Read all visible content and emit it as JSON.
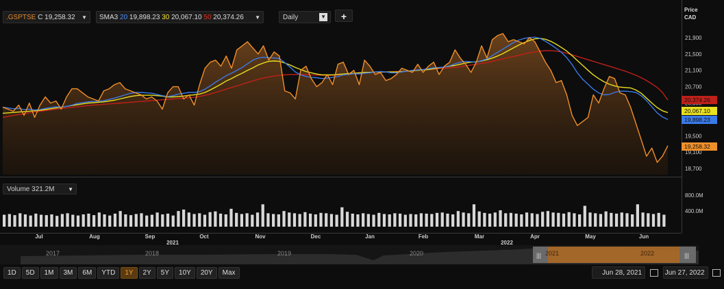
{
  "header": {
    "symbol": ".GSPTSE",
    "symbol_value": "C 19,258.32",
    "sma_label": "SMA3",
    "sma": [
      {
        "period": "20",
        "value": "19,898.23",
        "color": "#4a90ff"
      },
      {
        "period": "30",
        "value": "20,067.10",
        "color": "#f0e030"
      },
      {
        "period": "50",
        "value": "20,374.26",
        "color": "#e03020"
      }
    ],
    "interval": "Daily",
    "add_icon": "plus-icon"
  },
  "price_axis": {
    "title_line1": "Price",
    "title_line2": "CAD"
  },
  "volume": {
    "label": "Volume 321.2M",
    "ticks": [
      "800.0M",
      "400.0M"
    ]
  },
  "time_range": {
    "start": "Jun 28, 2021",
    "end": "Jun 27, 2022"
  },
  "periods": [
    "1D",
    "5D",
    "1M",
    "3M",
    "6M",
    "YTD",
    "1Y",
    "2Y",
    "5Y",
    "10Y",
    "20Y",
    "Max"
  ],
  "active_period": "1Y",
  "navigator_years": [
    "2017",
    "2018",
    "2019",
    "2020",
    "2021",
    "2022"
  ],
  "chart_data": {
    "type": "area",
    "x_labels": [
      "Jul",
      "Aug",
      "Sep",
      "Oct",
      "Nov",
      "Dec",
      "Jan",
      "Feb",
      "Mar",
      "Apr",
      "May",
      "Jun"
    ],
    "year_labels": [
      "2021",
      "2022"
    ],
    "y_ticks": [
      18700,
      19100,
      19500,
      20300,
      20700,
      21100,
      21500,
      21900
    ],
    "y_tick_labels": [
      "18,700",
      "19,100",
      "19,500",
      "20,300",
      "20,700",
      "21,100",
      "21,500",
      "21,900"
    ],
    "ylim": [
      18550,
      22150
    ],
    "price_tags": [
      {
        "label": "20,374.26",
        "value": 20374,
        "color": "#c0201a"
      },
      {
        "label": "20,067.10",
        "value": 20067,
        "color": "#e8e020"
      },
      {
        "label": "19,898.23",
        "value": 19898,
        "color": "#3a7ae8"
      },
      {
        "label": "19,258.32",
        "value": 19258,
        "color": "#f0902a"
      }
    ],
    "series": [
      {
        "values": [
          20200,
          20150,
          20100,
          20250,
          20000,
          20300,
          19950,
          20250,
          20450,
          20300,
          20350,
          20150,
          20450,
          20650,
          20650,
          20550,
          20450,
          20400,
          20350,
          20600,
          20650,
          20750,
          20800,
          20650,
          20600,
          20550,
          20500,
          20400,
          20450,
          20350,
          20150,
          20550,
          20700,
          20700,
          20400,
          20500,
          20250,
          20750,
          21150,
          21300,
          21350,
          21200,
          21450,
          21150,
          21600,
          21700,
          21800,
          21650,
          21500,
          21700,
          21350,
          21550,
          21450,
          20600,
          20550,
          20400,
          21100,
          21200,
          20900,
          20700,
          20800,
          21000,
          20750,
          21250,
          21300,
          21000,
          21100,
          20750,
          21350,
          21200,
          21000,
          21050,
          20850,
          20900,
          21000,
          21150,
          21100,
          21050,
          21250,
          21050,
          21200,
          21300,
          21000,
          21200,
          21300,
          21600,
          21400,
          21250,
          21050,
          21300,
          21700,
          21400,
          21850,
          21950,
          22000,
          21800,
          21850,
          21800,
          21750,
          21900,
          21800,
          21550,
          21300,
          21100,
          20800,
          20850,
          20500,
          20000,
          19750,
          19850,
          19950,
          20500,
          20300,
          20650,
          20950,
          20900,
          20550,
          20500,
          20200,
          19800,
          19400,
          19000,
          19200,
          18850,
          19000,
          19258
        ]
      },
      {
        "values": [
          20200,
          20180,
          20160,
          20170,
          20140,
          20150,
          20130,
          20140,
          20170,
          20190,
          20210,
          20200,
          20220,
          20250,
          20290,
          20310,
          20330,
          20340,
          20340,
          20360,
          20390,
          20420,
          20460,
          20500,
          20540,
          20560,
          20560,
          20550,
          20540,
          20510,
          20480,
          20460,
          20480,
          20520,
          20540,
          20560,
          20560,
          20580,
          20640,
          20720,
          20810,
          20890,
          20970,
          21030,
          21100,
          21170,
          21260,
          21350,
          21400,
          21420,
          21410,
          21400,
          21390,
          21290,
          21180,
          21060,
          20990,
          20950,
          20930,
          20920,
          20900,
          20910,
          20930,
          20950,
          20990,
          21000,
          21020,
          21010,
          21030,
          21040,
          21060,
          21070,
          21060,
          21040,
          21040,
          21060,
          21080,
          21100,
          21110,
          21120,
          21140,
          21160,
          21170,
          21180,
          21210,
          21260,
          21300,
          21320,
          21310,
          21300,
          21340,
          21380,
          21460,
          21540,
          21620,
          21700,
          21780,
          21840,
          21880,
          21900,
          21910,
          21880,
          21810,
          21730,
          21640,
          21540,
          21410,
          21240,
          21040,
          20880,
          20760,
          20640,
          20550,
          20500,
          20510,
          20560,
          20590,
          20590,
          20580,
          20560,
          20480,
          20360,
          20210,
          20060,
          19960,
          19898
        ]
      },
      {
        "values": [
          20050,
          20060,
          20070,
          20080,
          20090,
          20100,
          20110,
          20120,
          20140,
          20160,
          20180,
          20200,
          20220,
          20240,
          20260,
          20280,
          20300,
          20310,
          20320,
          20330,
          20350,
          20370,
          20400,
          20430,
          20460,
          20480,
          20490,
          20490,
          20490,
          20480,
          20470,
          20450,
          20450,
          20460,
          20470,
          20490,
          20500,
          20520,
          20560,
          20620,
          20690,
          20760,
          20840,
          20900,
          20970,
          21030,
          21100,
          21160,
          21230,
          21280,
          21320,
          21330,
          21320,
          21280,
          21230,
          21170,
          21120,
          21070,
          21040,
          21010,
          20990,
          20990,
          20990,
          21000,
          21010,
          21020,
          21030,
          21040,
          21050,
          21050,
          21060,
          21060,
          21060,
          21060,
          21060,
          21070,
          21080,
          21090,
          21100,
          21110,
          21120,
          21140,
          21160,
          21180,
          21200,
          21220,
          21250,
          21280,
          21300,
          21310,
          21330,
          21360,
          21400,
          21450,
          21510,
          21580,
          21650,
          21720,
          21780,
          21830,
          21870,
          21880,
          21860,
          21810,
          21740,
          21660,
          21570,
          21460,
          21340,
          21220,
          21100,
          20990,
          20900,
          20820,
          20760,
          20720,
          20690,
          20680,
          20670,
          20620,
          20540,
          20420,
          20300,
          20190,
          20110,
          20067
        ]
      },
      {
        "values": [
          19950,
          19975,
          20000,
          20020,
          20040,
          20060,
          20080,
          20100,
          20115,
          20130,
          20150,
          20165,
          20180,
          20195,
          20210,
          20225,
          20240,
          20250,
          20260,
          20270,
          20280,
          20290,
          20300,
          20310,
          20320,
          20330,
          20340,
          20350,
          20360,
          20370,
          20380,
          20390,
          20400,
          20410,
          20420,
          20430,
          20440,
          20460,
          20490,
          20520,
          20560,
          20600,
          20640,
          20680,
          20720,
          20760,
          20800,
          20840,
          20880,
          20910,
          20940,
          20960,
          20980,
          20990,
          21000,
          21000,
          21000,
          20995,
          20990,
          20985,
          20980,
          20980,
          20980,
          20990,
          21000,
          21010,
          21020,
          21030,
          21040,
          21045,
          21050,
          21055,
          21060,
          21065,
          21070,
          21075,
          21080,
          21090,
          21100,
          21110,
          21120,
          21130,
          21140,
          21150,
          21160,
          21170,
          21190,
          21210,
          21230,
          21250,
          21270,
          21290,
          21320,
          21350,
          21380,
          21410,
          21440,
          21470,
          21500,
          21530,
          21550,
          21570,
          21580,
          21580,
          21570,
          21550,
          21520,
          21480,
          21440,
          21400,
          21360,
          21320,
          21280,
          21240,
          21200,
          21160,
          21120,
          21080,
          21030,
          20980,
          20920,
          20850,
          20770,
          20680,
          20560,
          20374
        ]
      }
    ],
    "volume_values": [
      320,
      340,
      310,
      360,
      330,
      300,
      350,
      320,
      310,
      330,
      290,
      340,
      360,
      320,
      300,
      330,
      350,
      310,
      380,
      330,
      300,
      350,
      420,
      330,
      310,
      340,
      360,
      300,
      320,
      380,
      330,
      350,
      300,
      420,
      460,
      380,
      340,
      360,
      320,
      390,
      410,
      350,
      330,
      480,
      370,
      340,
      360,
      320,
      380,
      600,
      360,
      340,
      330,
      420,
      380,
      360,
      340,
      390,
      350,
      330,
      370,
      360,
      340,
      320,
      520,
      400,
      350,
      330,
      360,
      340,
      320,
      370,
      340,
      330,
      360,
      350,
      320,
      340,
      330,
      360,
      350,
      340,
      370,
      380,
      350,
      330,
      420,
      380,
      360,
      600,
      410,
      370,
      350,
      380,
      440,
      360,
      370,
      350,
      330,
      380,
      360,
      340,
      400,
      420,
      380,
      370,
      350,
      390,
      360,
      330,
      560,
      380,
      360,
      340,
      410,
      370,
      350,
      380,
      360,
      330,
      600,
      380,
      360,
      340,
      370,
      321
    ]
  }
}
